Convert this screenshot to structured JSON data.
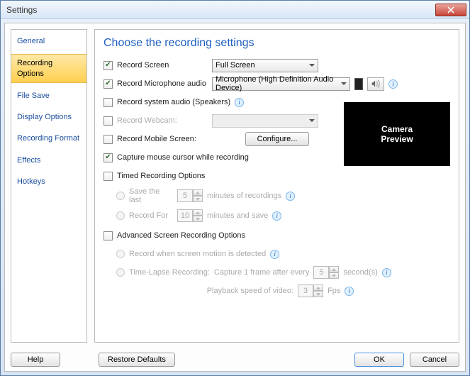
{
  "window": {
    "title": "Settings"
  },
  "sidebar": {
    "items": [
      {
        "label": "General"
      },
      {
        "label": "Recording Options"
      },
      {
        "label": "File Save"
      },
      {
        "label": "Display Options"
      },
      {
        "label": "Recording Format"
      },
      {
        "label": "Effects"
      },
      {
        "label": "Hotkeys"
      }
    ]
  },
  "main": {
    "heading": "Choose the recording settings",
    "record_screen": "Record Screen",
    "screen_mode": "Full Screen",
    "record_mic": "Record Microphone audio",
    "mic_device": "Microphone (High Definition Audio Device)",
    "record_sys_audio": "Record system audio (Speakers)",
    "record_webcam": "Record Webcam:",
    "record_mobile": "Record Mobile Screen:",
    "configure": "Configure...",
    "capture_cursor": "Capture mouse cursor while recording",
    "timed_recording": "Timed Recording Options",
    "save_last": "Save the last",
    "save_last_val": "5",
    "save_last_unit": "minutes of recordings",
    "record_for": "Record For",
    "record_for_val": "10",
    "record_for_unit": "minutes and save",
    "advanced": "Advanced Screen Recording Options",
    "motion_detect": "Record when screen motion is detected",
    "timelapse": "Time-Lapse Recording:",
    "tl_prefix": "Capture 1 frame after every",
    "tl_val": "5",
    "tl_unit": "second(s)",
    "playback_label": "Playback speed of video:",
    "playback_val": "3",
    "playback_unit": "Fps",
    "camera_preview_l1": "Camera",
    "camera_preview_l2": "Preview"
  },
  "footer": {
    "help": "Help",
    "restore": "Restore Defaults",
    "ok": "OK",
    "cancel": "Cancel"
  }
}
